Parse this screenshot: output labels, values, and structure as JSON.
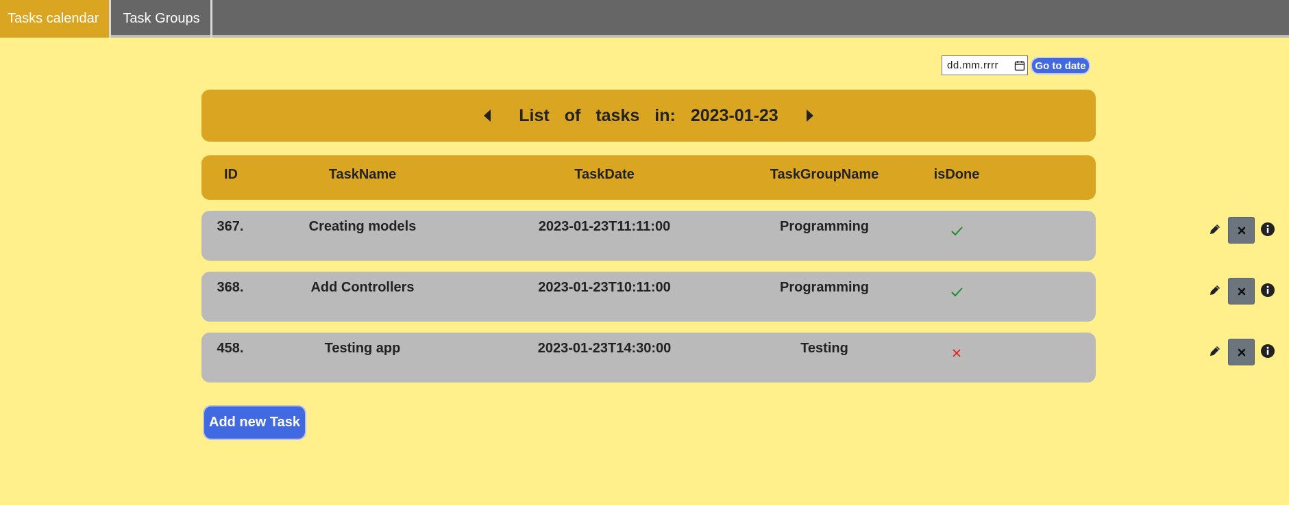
{
  "nav": {
    "tabs": [
      {
        "label": "Tasks calendar",
        "active": true
      },
      {
        "label": "Task Groups",
        "active": false
      }
    ]
  },
  "date_picker": {
    "placeholder": "dd.mm.rrrr",
    "go_label": "Go to date"
  },
  "header": {
    "words": [
      "List",
      "of",
      "tasks",
      "in:",
      "2023-01-23"
    ]
  },
  "table": {
    "columns": [
      "ID",
      "TaskName",
      "TaskDate",
      "TaskGroupName",
      "isDone"
    ],
    "rows": [
      {
        "id": "367.",
        "name": "Creating models",
        "date": "2023-01-23T11:11:00",
        "group": "Programming",
        "done": true
      },
      {
        "id": "368.",
        "name": "Add Controllers",
        "date": "2023-01-23T10:11:00",
        "group": "Programming",
        "done": true
      },
      {
        "id": "458.",
        "name": "Testing app",
        "date": "2023-01-23T14:30:00",
        "group": "Testing",
        "done": false
      }
    ]
  },
  "add_button": {
    "label": "Add new Task"
  },
  "colors": {
    "background": "#fff08c",
    "accent": "#daa520",
    "nav": "#666666",
    "row": "#bababa",
    "primary_button": "#4169e1",
    "done_check": "#1e8c2e",
    "not_done_cross": "#e02020"
  },
  "icons": {
    "prev": "caret-left-icon",
    "next": "caret-right-icon",
    "edit": "pencil-icon",
    "delete": "x-icon",
    "info": "info-circle-icon",
    "calendar": "calendar-icon"
  }
}
